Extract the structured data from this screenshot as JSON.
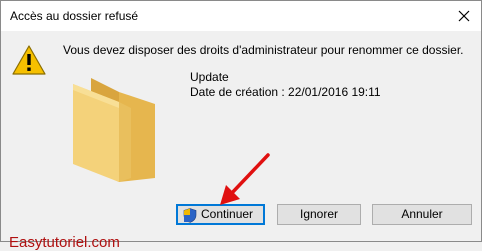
{
  "window": {
    "title": "Accès au dossier refusé"
  },
  "message": {
    "text": "Vous devez disposer des droits d'administrateur pour renommer ce dossier."
  },
  "item": {
    "name": "Update",
    "date": "Date de création : 22/01/2016 19:11"
  },
  "buttons": {
    "continue": "Continuer",
    "ignore": "Ignorer",
    "cancel": "Annuler"
  },
  "watermark": "Easytutoriel.com",
  "icons": {
    "close": "close-icon",
    "warning": "warning-icon",
    "folder": "folder-icon",
    "shield": "uac-shield-icon",
    "arrow": "red-arrow"
  },
  "colors": {
    "accent": "#0078d7",
    "warning": "#f6c000",
    "folder": "#f0cb6a",
    "annotation": "#e01010"
  }
}
